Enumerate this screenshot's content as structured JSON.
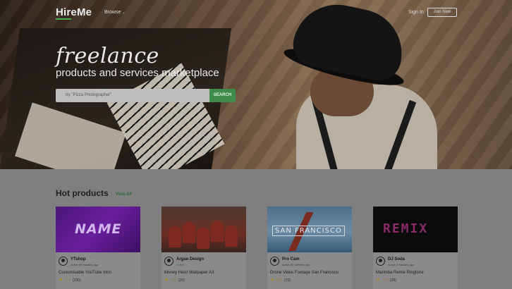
{
  "nav": {
    "logo": "HireMe",
    "browse": "Browse",
    "sign_in": "Sign In",
    "join_now": "Join Now"
  },
  "hero": {
    "tagline_script": "freelance",
    "tagline": "products and services marketplace",
    "search_placeholder": "try \"Pizza Photographer\"",
    "search_button": "SEARCH"
  },
  "section": {
    "title": "Hot products",
    "view_all": "View All"
  },
  "products": [
    {
      "seller": "YTshop",
      "active": "Active 59 minutes ago",
      "title": "Customisable YouTube Intro",
      "rating": "5.0",
      "count": "(230)",
      "thumb_text": "NAME"
    },
    {
      "seller": "Argan Design",
      "active": "Online",
      "title": "Money Heist Wallpaper A3",
      "rating": "5.0",
      "count": "(20)",
      "thumb_text": ""
    },
    {
      "seller": "Pro Cam",
      "active": "Active 59 minutes ago",
      "title": "Drone Video Footage San Francisco",
      "rating": "5.0",
      "count": "(70)",
      "thumb_text": "SAN FRANCISCO"
    },
    {
      "seller": "DJ Soda",
      "active": "Active 2 minutes ago",
      "title": "Marimba Remix Ringtone",
      "rating": "5.0",
      "count": "(20)",
      "thumb_text": "REMIX"
    }
  ],
  "colors": {
    "accent_green": "#4caf50",
    "search_button": "#3e8b4c",
    "star": "#a8882a"
  },
  "icons": {
    "rating": "star-icon",
    "seller": "user-avatar-icon",
    "browse": "chevron-down-icon"
  }
}
